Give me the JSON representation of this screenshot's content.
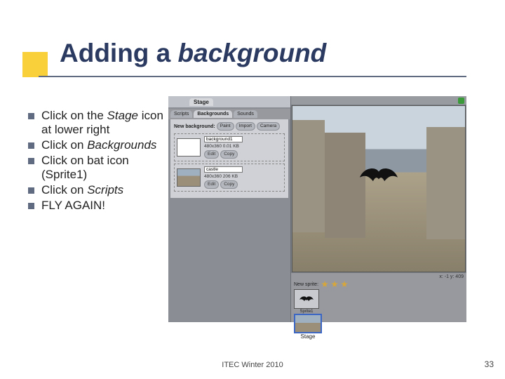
{
  "title": {
    "plain": "Adding a ",
    "em": "background"
  },
  "bullets": [
    {
      "pre": "Click on the ",
      "em": "Stage",
      "post": " icon at lower right"
    },
    {
      "pre": "Click on ",
      "em": "Backgrounds",
      "post": ""
    },
    {
      "pre": "Click on bat icon (Sprite1)",
      "em": "",
      "post": ""
    },
    {
      "pre": "Click on ",
      "em": "Scripts",
      "post": ""
    },
    {
      "pre": "FLY AGAIN!",
      "em": "",
      "post": ""
    }
  ],
  "scratch": {
    "stage_label": "Stage",
    "tabs": {
      "scripts": "Scripts",
      "backgrounds": "Backgrounds",
      "sounds": "Sounds"
    },
    "newbg_label": "New background:",
    "buttons": {
      "paint": "Paint",
      "import": "Import",
      "camera": "Camera",
      "edit": "Edit",
      "copy": "Copy"
    },
    "items": [
      {
        "name": "background1",
        "meta": "480x360   0.01 KB"
      },
      {
        "name": "castle",
        "meta": "480x360   206 KB"
      }
    ],
    "new_sprite_label": "New sprite:",
    "sprite1_label": "Sprite1",
    "stage_thumb_label": "Stage",
    "xy": "x: -1  y: 409"
  },
  "footer": "ITEC Winter 2010",
  "slide_no": "33"
}
